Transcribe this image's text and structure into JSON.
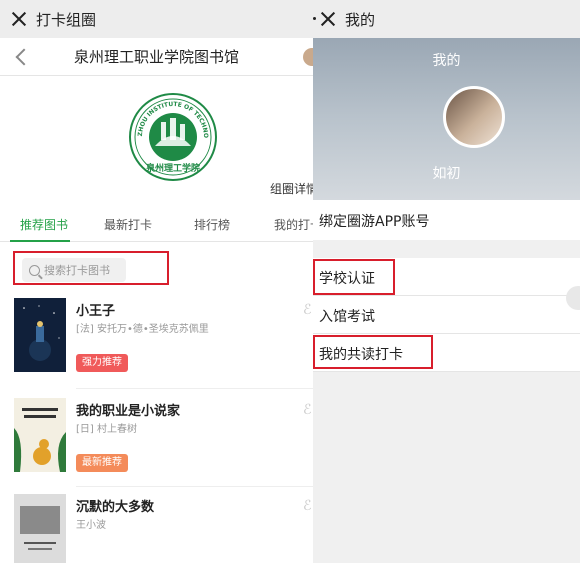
{
  "left": {
    "topbar_title": "打卡组圈",
    "nav_title": "泉州理工职业学院图书馆",
    "logo_text_top": "QUANZHOU INSTITUTE OF TECHNOLOGY",
    "logo_text_bottom": "泉州理工学院",
    "group_detail": "组圈详情",
    "tabs": [
      "推荐图书",
      "最新打卡",
      "排行榜",
      "我的打卡"
    ],
    "search_placeholder": "搜索打卡图书",
    "books": [
      {
        "title": "小王子",
        "author": "[法] 安托万•德•圣埃克苏佩里",
        "badge": "强力推荐",
        "badge_color": "#f05a5a"
      },
      {
        "title": "我的职业是小说家",
        "author": "[日] 村上春树",
        "badge": "最新推荐",
        "badge_color": "#f48b5a"
      },
      {
        "title": "沉默的大多数",
        "author": "王小波"
      }
    ]
  },
  "right": {
    "topbar_title": "我的",
    "hero_title": "我的",
    "username": "如初",
    "bind_label": "绑定圈游APP账号",
    "menu": [
      "学校认证",
      "入馆考试",
      "我的共读打卡"
    ]
  },
  "colors": {
    "accent": "#24a148",
    "highlight": "#d81e2c"
  }
}
